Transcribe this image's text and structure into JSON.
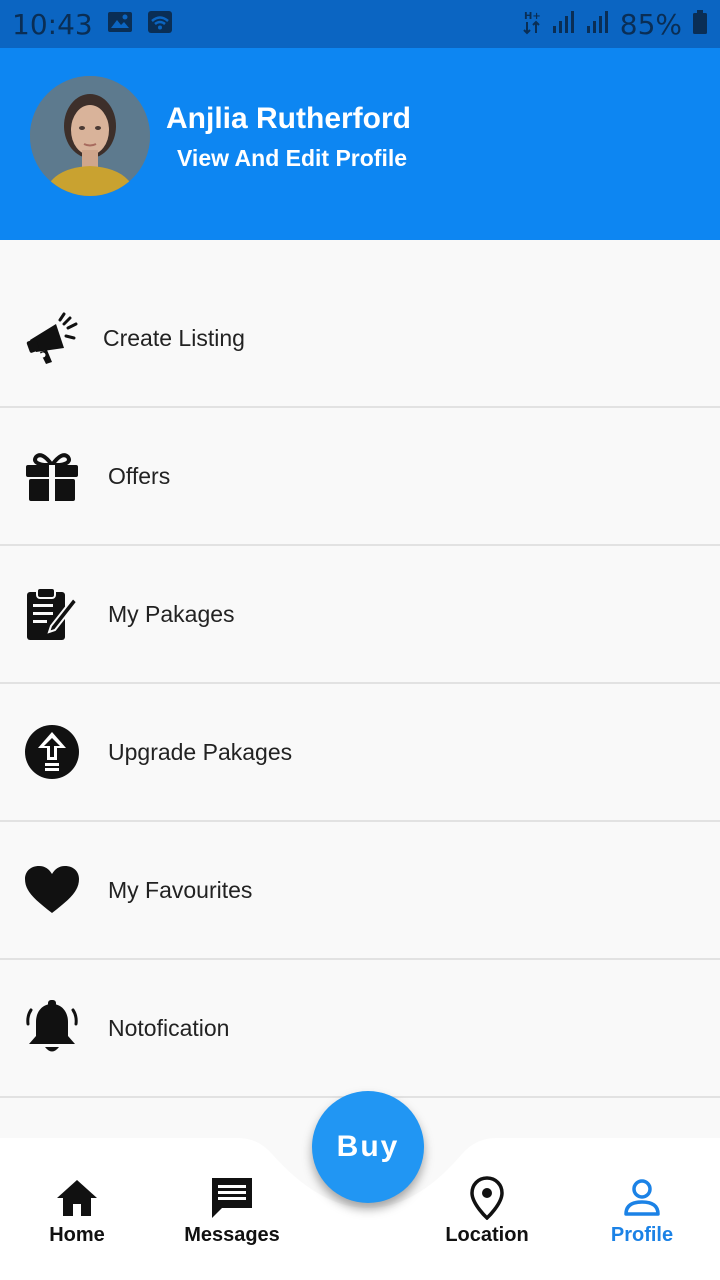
{
  "status_bar": {
    "time": "10:43",
    "battery": "85%",
    "icons": [
      "image-icon",
      "wifi-icon",
      "data-icon",
      "signal-icon",
      "signal-icon",
      "battery-icon"
    ]
  },
  "header": {
    "user_name": "Anjlia Rutherford",
    "profile_link": "View And Edit Profile",
    "background_color": "#0d86f2"
  },
  "menu": {
    "items": [
      {
        "label": "Create Listing",
        "icon": "megaphone-icon"
      },
      {
        "label": "Offers",
        "icon": "gift-icon"
      },
      {
        "label": "My Pakages",
        "icon": "clipboard-edit-icon"
      },
      {
        "label": "Upgrade Pakages",
        "icon": "upgrade-arrow-icon"
      },
      {
        "label": "My Favourites",
        "icon": "heart-icon"
      },
      {
        "label": "Notofication",
        "icon": "bell-icon"
      }
    ]
  },
  "bottom_nav": {
    "items": [
      {
        "label": "Home",
        "icon": "home-icon"
      },
      {
        "label": "Messages",
        "icon": "message-icon"
      },
      {
        "label": "Location",
        "icon": "location-pin-icon"
      },
      {
        "label": "Profile",
        "icon": "person-icon",
        "active": true
      }
    ],
    "fab_label": "Buy",
    "accent_color": "#2196f3"
  }
}
